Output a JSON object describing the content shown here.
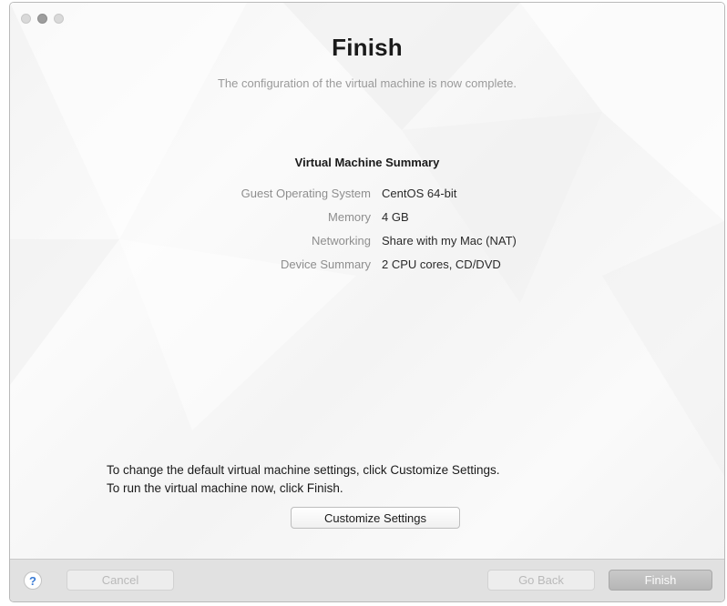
{
  "window": {
    "heading": "Finish",
    "subheading": "The configuration of the virtual machine is now complete."
  },
  "summary": {
    "heading": "Virtual Machine Summary",
    "rows": [
      {
        "label": "Guest Operating System",
        "value": "CentOS 64-bit"
      },
      {
        "label": "Memory",
        "value": "4 GB"
      },
      {
        "label": "Networking",
        "value": "Share with my Mac (NAT)"
      },
      {
        "label": "Device Summary",
        "value": "2 CPU cores, CD/DVD"
      }
    ]
  },
  "info": {
    "line1": "To change the default virtual machine settings, click Customize Settings.",
    "line2": "To run the virtual machine now, click Finish."
  },
  "buttons": {
    "customize": "Customize Settings",
    "help": "?",
    "cancel": "Cancel",
    "go_back": "Go Back",
    "finish": "Finish"
  },
  "icons": {
    "window_controls": [
      "close-icon",
      "minimize-icon",
      "zoom-icon"
    ],
    "help": "help-icon"
  }
}
